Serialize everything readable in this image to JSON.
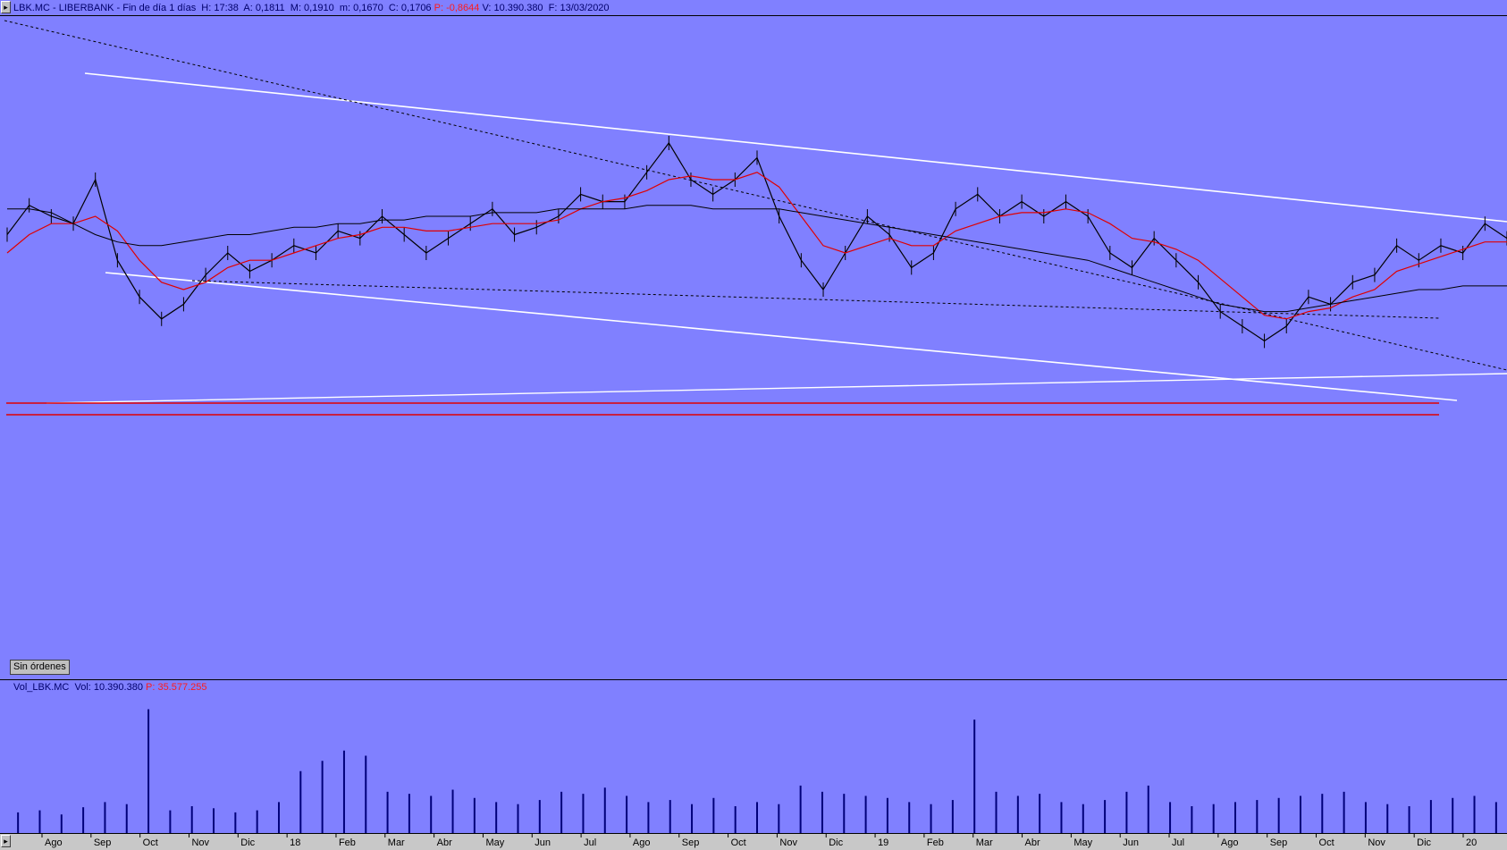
{
  "header": {
    "ticker_line": "LBK.MC - LIBERBANK - Fin de día 1 días  H: 17:38  A: 0,1811  M: 0,1910  m: 0,1670  C: 0,1706",
    "p_label": "P: -0,8644",
    "rest_line": "V: 10.390.380  F: 13/03/2020"
  },
  "orders_button": "Sin órdenes",
  "volume_header": {
    "label": "Vol_LBK.MC  Vol: 10.390.380",
    "p_label": "P: 35.577.255"
  },
  "x_axis": {
    "labels": [
      "Ago",
      "Sep",
      "Oct",
      "Nov",
      "Dic",
      "18",
      "Feb",
      "Mar",
      "Abr",
      "May",
      "Jun",
      "Jul",
      "Ago",
      "Sep",
      "Oct",
      "Nov",
      "Dic",
      "19",
      "Feb",
      "Mar",
      "Abr",
      "May",
      "Jun",
      "Jul",
      "Ago",
      "Sep",
      "Oct",
      "Nov",
      "Dic",
      "20"
    ]
  },
  "colors": {
    "background": "#8080ff",
    "price": "#000000",
    "ma_short": "#e00000",
    "ma_long": "#000000",
    "trendline": "#ffffff",
    "support": "#e00000",
    "volume": "#00007a"
  },
  "chart_data": {
    "type": "line",
    "series": [
      {
        "values": [
          55,
          63,
          60,
          58,
          70,
          48,
          38,
          32,
          36,
          44,
          50,
          45,
          48,
          52,
          50,
          56,
          54,
          60,
          55,
          50,
          54,
          58,
          62,
          55,
          57,
          60,
          66,
          64,
          64,
          72,
          80,
          70,
          66,
          70,
          76,
          60,
          48,
          40,
          50,
          60,
          55,
          46,
          50,
          62,
          66,
          60,
          64,
          60,
          64,
          60,
          50,
          46,
          54,
          48,
          42,
          34,
          30,
          26,
          30,
          38,
          36,
          42,
          44,
          52,
          48,
          52,
          50,
          58,
          54
        ]
      },
      {
        "values": [
          50,
          55,
          58,
          58,
          60,
          56,
          48,
          42,
          40,
          42,
          46,
          48,
          48,
          50,
          52,
          54,
          55,
          57,
          57,
          56,
          56,
          57,
          58,
          58,
          58,
          59,
          62,
          64,
          65,
          67,
          70,
          71,
          70,
          70,
          72,
          68,
          60,
          52,
          50,
          52,
          54,
          52,
          52,
          56,
          58,
          60,
          61,
          61,
          62,
          61,
          58,
          54,
          53,
          51,
          48,
          43,
          38,
          33,
          32,
          34,
          35,
          38,
          40,
          45,
          47,
          49,
          51,
          53,
          53
        ]
      },
      {
        "values": [
          62,
          62,
          61,
          58,
          55,
          53,
          52,
          52,
          53,
          54,
          55,
          55,
          56,
          57,
          57,
          58,
          58,
          59,
          59,
          60,
          60,
          60,
          61,
          61,
          61,
          62,
          62,
          62,
          62,
          63,
          63,
          63,
          62,
          62,
          62,
          62,
          61,
          60,
          59,
          58,
          57,
          56,
          55,
          54,
          53,
          52,
          51,
          50,
          49,
          48,
          46,
          44,
          42,
          40,
          38,
          36,
          35,
          34,
          34,
          35,
          36,
          37,
          38,
          39,
          40,
          40,
          41,
          41,
          41
        ]
      }
    ],
    "volume": [
      20,
      22,
      18,
      25,
      30,
      28,
      120,
      22,
      26,
      24,
      20,
      22,
      30,
      60,
      70,
      80,
      75,
      40,
      38,
      36,
      42,
      34,
      30,
      28,
      32,
      40,
      38,
      44,
      36,
      30,
      32,
      28,
      34,
      26,
      30,
      28,
      46,
      40,
      38,
      36,
      34,
      30,
      28,
      32,
      110,
      40,
      36,
      38,
      30,
      28,
      32,
      40,
      46,
      30,
      26,
      28,
      30,
      32,
      34,
      36,
      38,
      40,
      30,
      28,
      26,
      32,
      34,
      36,
      30
    ]
  }
}
